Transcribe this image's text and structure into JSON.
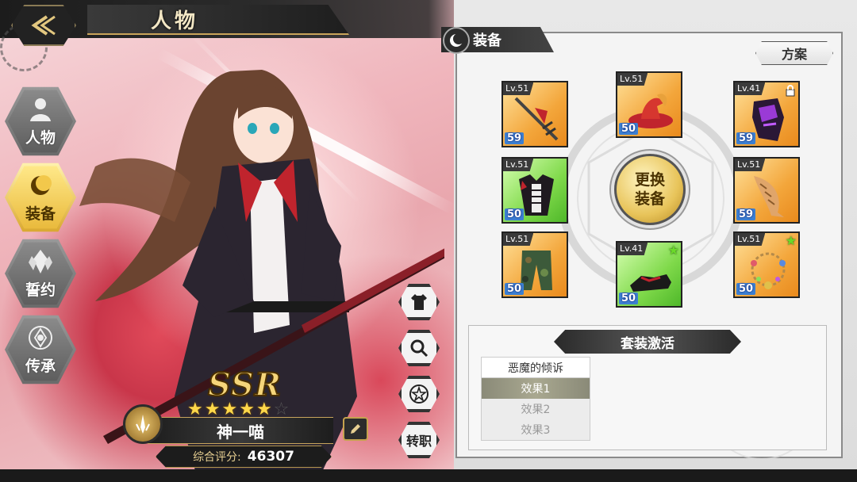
{
  "header": {
    "title": "人物"
  },
  "side_nav": [
    {
      "label": "人物",
      "icon": "person-icon",
      "active": false
    },
    {
      "label": "装备",
      "icon": "moon-icon",
      "active": true
    },
    {
      "label": "誓约",
      "icon": "crystal-icon",
      "active": false
    },
    {
      "label": "传承",
      "icon": "flower-icon",
      "active": false
    }
  ],
  "action_buttons": [
    {
      "icon": "outfit-icon"
    },
    {
      "icon": "magnify-icon"
    },
    {
      "icon": "star-icon"
    },
    {
      "label": "转职"
    }
  ],
  "character": {
    "rarity": "SSR",
    "stars_filled": 5,
    "stars_total": 6,
    "name": "神一喵",
    "score_label": "综合评分:",
    "score_value": "46307"
  },
  "equip": {
    "title": "装备",
    "plan_label": "方案",
    "change_label_1": "更换",
    "change_label_2": "装备",
    "slots": [
      {
        "level": "Lv.51",
        "enhance": "59",
        "rarity": "orange",
        "icon": "spear-icon",
        "locked": false
      },
      {
        "level": "Lv.51",
        "enhance": "50",
        "rarity": "orange",
        "icon": "hat-icon",
        "locked": false
      },
      {
        "level": "Lv.41",
        "enhance": "59",
        "rarity": "orange",
        "icon": "gauntlet-icon",
        "locked": true
      },
      {
        "level": "Lv.51",
        "enhance": "50",
        "rarity": "green",
        "icon": "armor-icon",
        "locked": false
      },
      {
        "level": "Lv.51",
        "enhance": "59",
        "rarity": "orange",
        "icon": "fish-icon",
        "locked": false
      },
      {
        "level": "Lv.51",
        "enhance": "50",
        "rarity": "orange",
        "icon": "pants-icon",
        "locked": false
      },
      {
        "level": "Lv.41",
        "enhance": "50",
        "rarity": "green",
        "icon": "shoe-icon",
        "locked": false,
        "starred": true
      },
      {
        "level": "Lv.51",
        "enhance": "50",
        "rarity": "orange",
        "icon": "necklace-icon",
        "locked": false,
        "starred": true
      }
    ]
  },
  "set_bonus": {
    "title": "套装激活",
    "set_name": "恶魔的倾诉",
    "effects": [
      "效果1",
      "效果2",
      "效果3"
    ],
    "active_index": 0
  }
}
